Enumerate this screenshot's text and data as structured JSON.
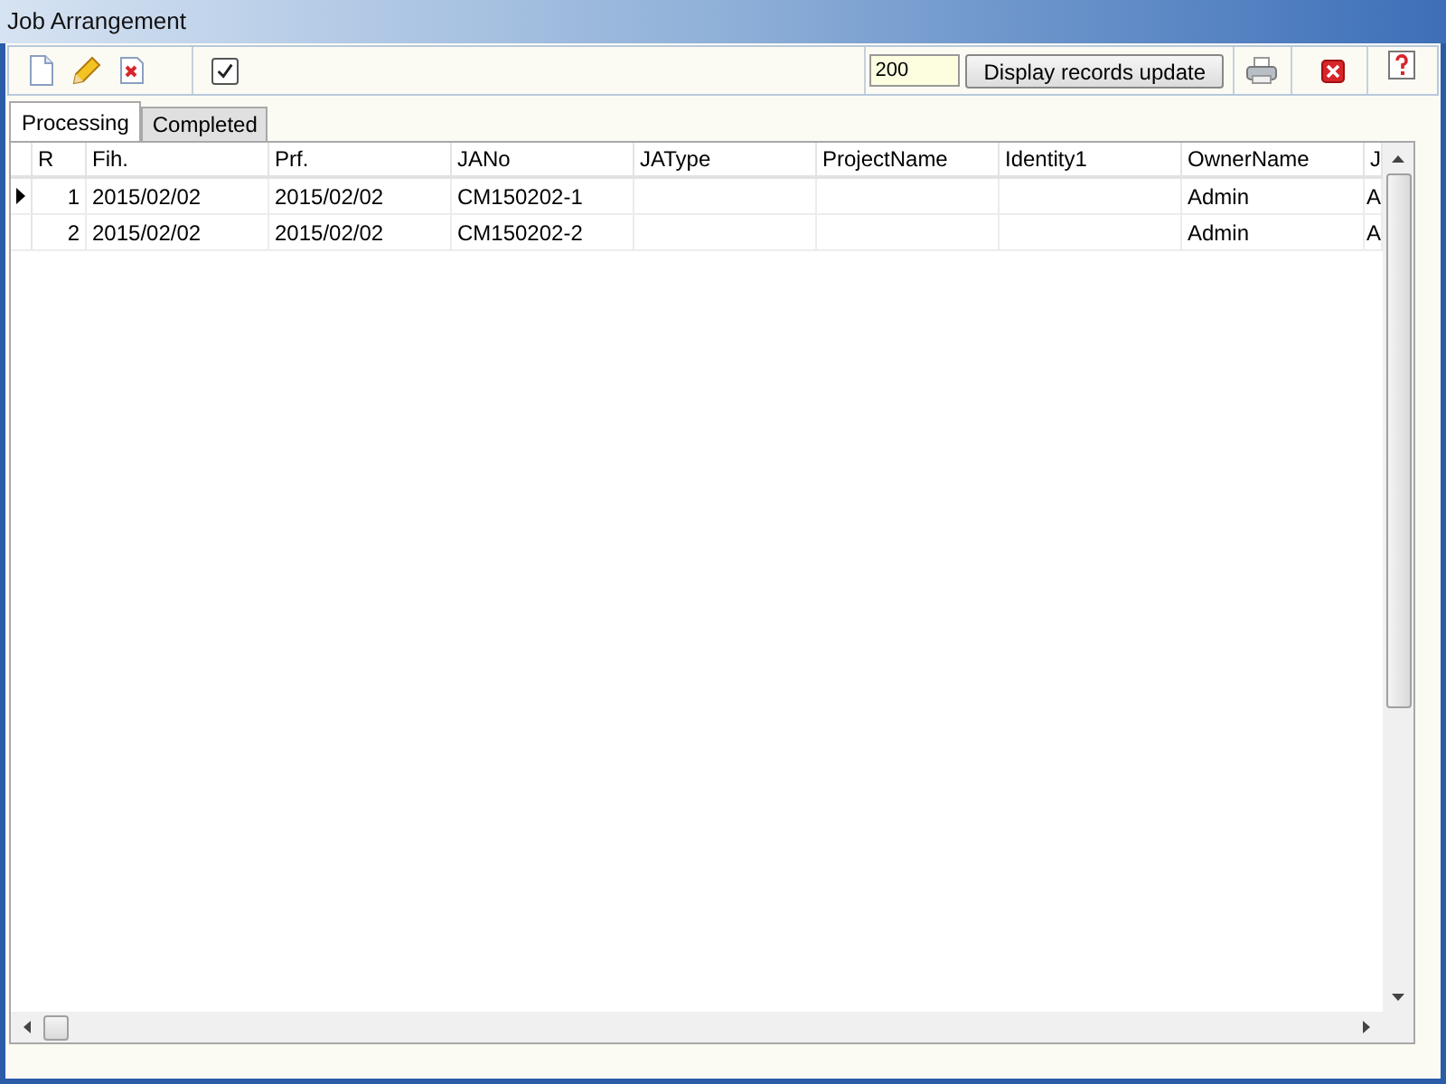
{
  "window": {
    "title": "Job Arrangement"
  },
  "toolbar": {
    "show_all_checked": true,
    "record_count": "200",
    "update_button": "Display records update"
  },
  "tabs": [
    {
      "label": "Processing",
      "selected": true
    },
    {
      "label": "Completed",
      "selected": false
    }
  ],
  "table": {
    "columns": [
      "R",
      "Fih.",
      "Prf.",
      "JANo",
      "JAType",
      "ProjectName",
      "Identity1",
      "OwnerName",
      "J"
    ],
    "rows": [
      {
        "current": true,
        "cells": [
          "1",
          "2015/02/02",
          "2015/02/02",
          "CM150202-1",
          "",
          "",
          "",
          "Admin",
          "A"
        ]
      },
      {
        "current": false,
        "cells": [
          "2",
          "2015/02/02",
          "2015/02/02",
          "CM150202-2",
          "",
          "",
          "",
          "Admin",
          "A"
        ]
      }
    ]
  }
}
